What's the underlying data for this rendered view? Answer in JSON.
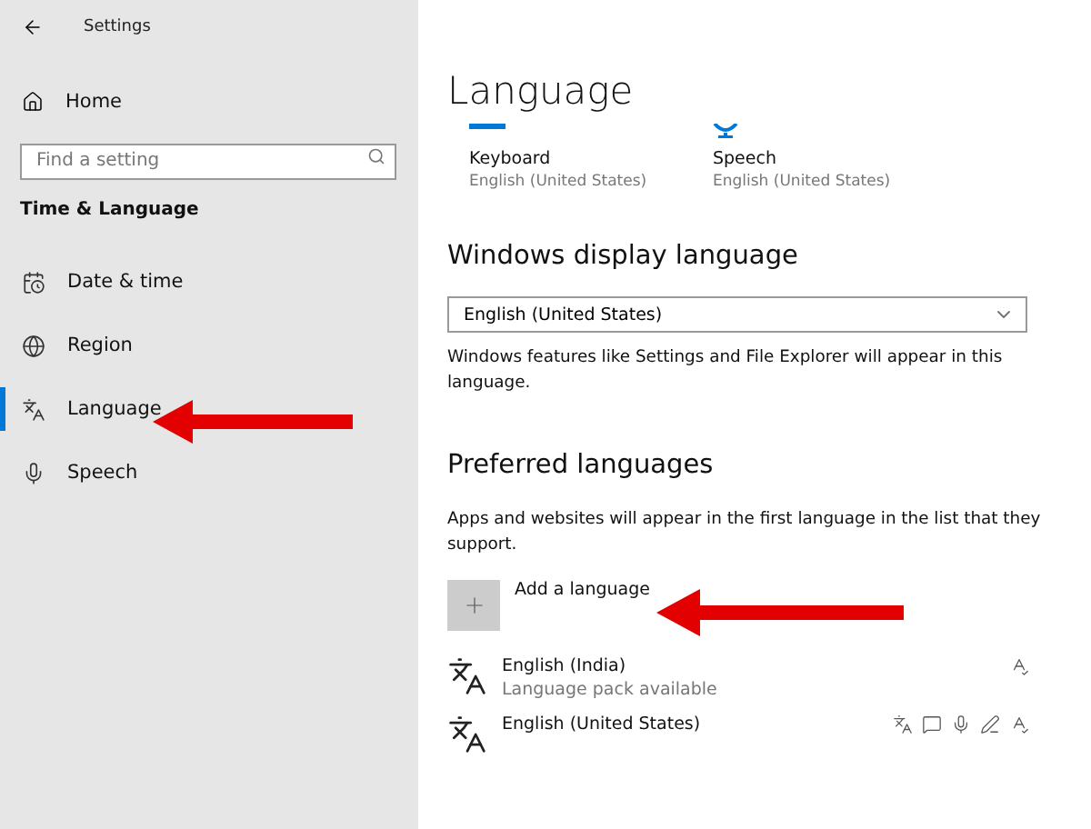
{
  "window": {
    "title": "Settings"
  },
  "sidebar": {
    "home": "Home",
    "search": {
      "placeholder": "Find a setting"
    },
    "section": "Time & Language",
    "items": [
      {
        "label": "Date & time",
        "kind": "date",
        "selected": false
      },
      {
        "label": "Region",
        "kind": "region",
        "selected": false
      },
      {
        "label": "Language",
        "kind": "language",
        "selected": true
      },
      {
        "label": "Speech",
        "kind": "speech",
        "selected": false
      }
    ]
  },
  "page": {
    "title": "Language",
    "defaults": [
      {
        "kind": "keyboard",
        "label": "Keyboard",
        "value": "English (United States)"
      },
      {
        "kind": "speech",
        "label": "Speech",
        "value": "English (United States)"
      }
    ],
    "display_language": {
      "heading": "Windows display language",
      "value": "English (United States)",
      "description": "Windows features like Settings and File Explorer will appear in this language."
    },
    "preferred": {
      "heading": "Preferred languages",
      "description": "Apps and websites will appear in the first language in the list that they support.",
      "add_button": "Add a language",
      "languages": [
        {
          "name": "English (India)",
          "status": "Language pack available",
          "features": [
            {
              "kind": "spelling"
            }
          ]
        },
        {
          "name": "English (United States)",
          "features": [
            {
              "kind": "display"
            },
            {
              "kind": "text-to-speech"
            },
            {
              "kind": "speech"
            },
            {
              "kind": "handwriting"
            },
            {
              "kind": "spelling"
            }
          ]
        }
      ]
    }
  }
}
